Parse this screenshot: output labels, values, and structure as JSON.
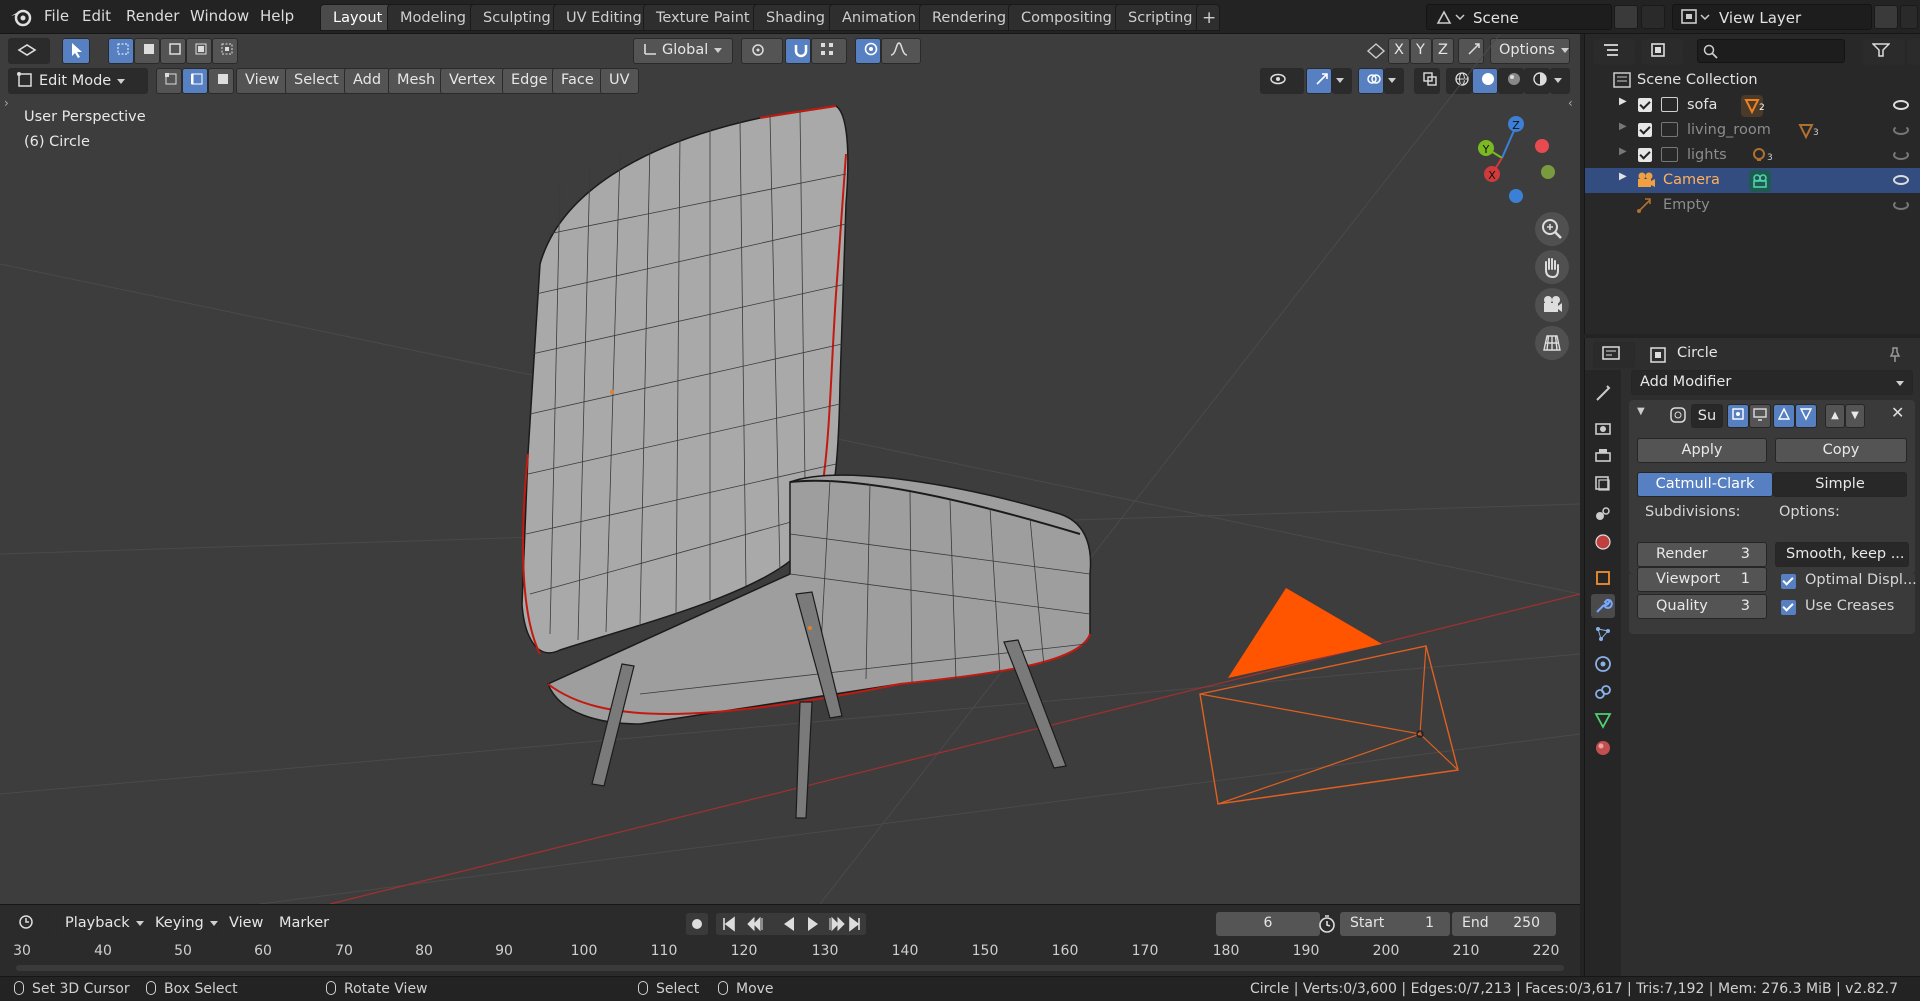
{
  "topbar": {
    "menus": [
      "File",
      "Edit",
      "Render",
      "Window",
      "Help"
    ],
    "workspaces": [
      "Layout",
      "Modeling",
      "Sculpting",
      "UV Editing",
      "Texture Paint",
      "Shading",
      "Animation",
      "Rendering",
      "Compositing",
      "Scripting"
    ],
    "active_workspace": "Layout",
    "scene_name": "Scene",
    "view_layer_name": "View Layer"
  },
  "viewport": {
    "mode": "Edit Mode",
    "menus": [
      "View",
      "Select",
      "Add",
      "Mesh",
      "Vertex",
      "Edge",
      "Face",
      "UV"
    ],
    "transform_orientation": "Global",
    "axis_labels": [
      "X",
      "Y",
      "Z"
    ],
    "options_label": "Options",
    "overlay_line1": "User Perspective",
    "overlay_line2": "(6) Circle",
    "gizmo": {
      "z": "Z",
      "y": "Y",
      "x": "X"
    }
  },
  "timeline": {
    "menus": [
      "Playback",
      "Keying",
      "View",
      "Marker"
    ],
    "current_frame": "6",
    "start_label": "Start",
    "start_value": "1",
    "end_label": "End",
    "end_value": "250",
    "ticks": [
      "30",
      "40",
      "50",
      "60",
      "70",
      "80",
      "90",
      "100",
      "110",
      "120",
      "130",
      "140",
      "150",
      "160",
      "170",
      "180",
      "190",
      "200",
      "210",
      "220"
    ]
  },
  "statusbar": {
    "hints": [
      "Set 3D Cursor",
      "Box Select",
      "Rotate View",
      "Select",
      "Move"
    ],
    "stats": "Circle | Verts:0/3,600 | Edges:0/7,213 | Faces:0/3,617 | Tris:7,192 | Mem: 276.3 MiB | v2.82.7"
  },
  "outliner": {
    "root": "Scene Collection",
    "items": [
      {
        "name": "sofa",
        "badge": "2"
      },
      {
        "name": "living_room",
        "badge": "3"
      },
      {
        "name": "lights",
        "badge": "3"
      },
      {
        "name": "Camera",
        "badge": ""
      },
      {
        "name": "Empty",
        "badge": ""
      }
    ]
  },
  "properties": {
    "object_name": "Circle",
    "add_modifier": "Add Modifier",
    "modifier_short": "Su",
    "apply": "Apply",
    "copy": "Copy",
    "catmull": "Catmull-Clark",
    "simple": "Simple",
    "subdivisions_label": "Subdivisions:",
    "options_label": "Options:",
    "render_label": "Render",
    "render_value": "3",
    "viewport_label": "Viewport",
    "viewport_value": "1",
    "quality_label": "Quality",
    "quality_value": "3",
    "uv_smooth": "Smooth, keep ...",
    "optimal_display": "Optimal Displ...",
    "use_creases": "Use Creases"
  },
  "colors": {
    "accent_blue": "#5680c2",
    "selection_orange": "#ff5500",
    "viewport_bg": "#3d3d3d"
  }
}
